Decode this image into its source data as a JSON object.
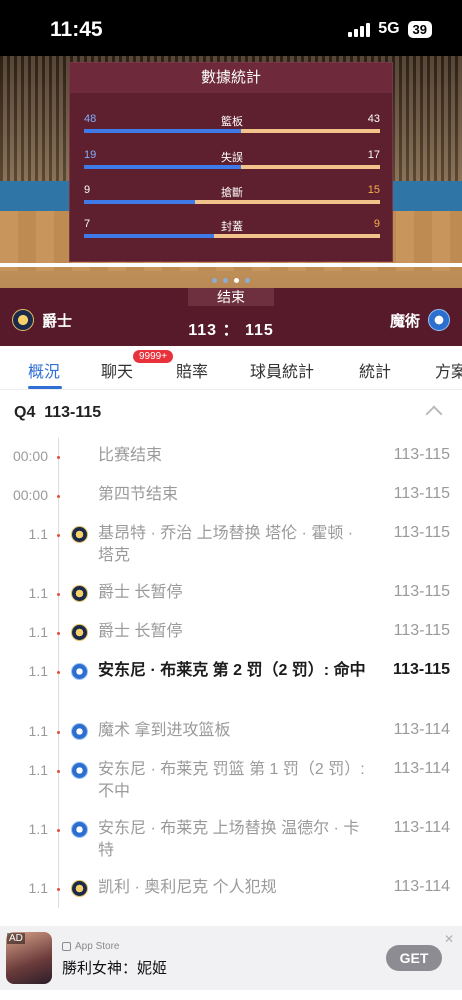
{
  "status_bar": {
    "time": "11:45",
    "network": "5G",
    "battery": "39"
  },
  "stats_panel": {
    "title": "數據統計",
    "rows": [
      {
        "label": "籃板",
        "home": "48",
        "away": "43",
        "home_share": 0.53
      },
      {
        "label": "失誤",
        "home": "19",
        "away": "17",
        "home_share": 0.53
      },
      {
        "label": "搶斷",
        "home": "9",
        "away": "15",
        "home_share": 0.375
      },
      {
        "label": "封蓋",
        "home": "7",
        "away": "9",
        "home_share": 0.4375
      }
    ],
    "page_count": 4,
    "active_page": 3
  },
  "match": {
    "status": "结束",
    "home_team": "爵士",
    "away_team": "魔術",
    "score": "113 ： 115"
  },
  "tabs": {
    "items": [
      "概況",
      "聊天",
      "賠率",
      "球員統計",
      "統計",
      "方案"
    ],
    "active": "概況",
    "chat_badge": "9999+"
  },
  "quarter": {
    "label": "Q4",
    "score": "113-115"
  },
  "events": [
    {
      "time": "00:00",
      "team": "",
      "desc": "比赛结束",
      "score": "113-115",
      "bold": false
    },
    {
      "time": "00:00",
      "team": "",
      "desc": "第四节结束",
      "score": "113-115",
      "bold": false
    },
    {
      "time": "1.1",
      "team": "jazz",
      "desc": "基昂特 · 乔治 上场替换 塔伦 · 霍顿 · 塔克",
      "score": "113-115",
      "bold": false
    },
    {
      "time": "1.1",
      "team": "jazz",
      "desc": "爵士 长暂停",
      "score": "113-115",
      "bold": false
    },
    {
      "time": "1.1",
      "team": "jazz",
      "desc": "爵士 长暂停",
      "score": "113-115",
      "bold": false
    },
    {
      "time": "1.1",
      "team": "magic",
      "desc": "安东尼 · 布莱克 第 2 罚（2 罚）: 命中",
      "score": "113-115",
      "bold": true
    },
    {
      "time": "1.1",
      "team": "magic",
      "desc": "魔术 拿到进攻篮板",
      "score": "113-114",
      "bold": false
    },
    {
      "time": "1.1",
      "team": "magic",
      "desc": "安东尼 · 布莱克 罚篮 第 1 罚（2 罚）: 不中",
      "score": "113-114",
      "bold": false
    },
    {
      "time": "1.1",
      "team": "magic",
      "desc": "安东尼 · 布莱克 上场替换 温德尔 · 卡特",
      "score": "113-114",
      "bold": false
    },
    {
      "time": "1.1",
      "team": "jazz",
      "desc": "凯利 · 奥利尼克 个人犯规",
      "score": "113-114",
      "bold": false
    }
  ],
  "ad": {
    "tag": "AD",
    "store": "App Store",
    "title": "勝利女神：妮姬",
    "button": "GET",
    "close": "✕"
  },
  "colors": {
    "accent": "#2f6fd6",
    "panel": "#5e1f2e",
    "home_bar": "#3e7be8",
    "away_bar": "#f2c38a"
  }
}
